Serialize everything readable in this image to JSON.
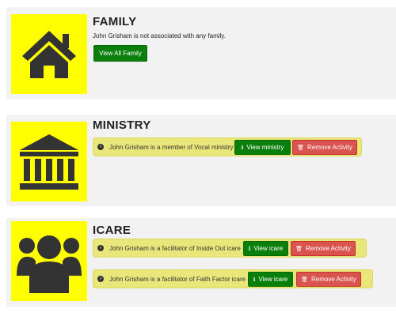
{
  "family": {
    "title": "FAMILY",
    "note": "John Grisham is not associated with any family.",
    "view_all_label": "View All Family",
    "icon": "house-icon"
  },
  "ministry": {
    "title": "MINISTRY",
    "icon": "building-columns-icon",
    "rows": [
      {
        "text": "John Grisham is a member of Vocal ministry",
        "view_label": "View ministry",
        "remove_label": "Remove Activity"
      }
    ]
  },
  "icare": {
    "title": "ICARE",
    "icon": "users-group-icon",
    "rows": [
      {
        "text": "John Grisham is a facilitator of Inside Out icare",
        "view_label": "View icare",
        "remove_label": "Remove Activity"
      },
      {
        "text": "John Grisham is a facilitator of Faith Factor icare",
        "view_label": "View icare",
        "remove_label": "Remove Activity"
      }
    ]
  },
  "colors": {
    "tile": "#ffff00",
    "row_bg": "#e9e77a",
    "green": "#0b7f0b",
    "red": "#d9534f"
  }
}
